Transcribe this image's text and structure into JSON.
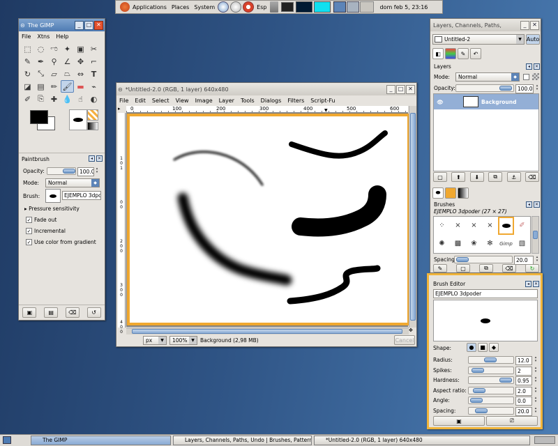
{
  "panel": {
    "applications": "Applications",
    "places": "Places",
    "system": "System",
    "keyboard": "Esp",
    "clock": "dom feb  5, 23:16"
  },
  "toolbox": {
    "title": "The GIMP",
    "menus": [
      "File",
      "Xtns",
      "Help"
    ]
  },
  "options": {
    "title": "Paintbrush",
    "opacity_label": "Opacity:",
    "opacity_value": "100.0",
    "mode_label": "Mode:",
    "mode_value": "Normal",
    "brush_label": "Brush:",
    "brush_value": "EJEMPLO 3dpoder",
    "pressure": "Pressure sensitivity",
    "fade": "Fade out",
    "incremental": "Incremental",
    "gradient": "Use color from gradient"
  },
  "image": {
    "title": "*Untitled-2.0 (RGB, 1 layer) 640x480",
    "menus": [
      "File",
      "Edit",
      "Select",
      "View",
      "Image",
      "Layer",
      "Tools",
      "Dialogs",
      "Filters",
      "Script-Fu"
    ],
    "ruler": [
      "0",
      "100",
      "200",
      "300",
      "400",
      "500",
      "600"
    ],
    "vruler": [
      "1",
      "0",
      "1",
      "0",
      "0",
      "2",
      "0",
      "0",
      "3",
      "0",
      "0",
      "4",
      "0",
      "0"
    ],
    "unit": "px",
    "zoom": "100%",
    "status": "Background (2,98 MB)",
    "cancel": "Cancel"
  },
  "layers_win": {
    "title": "Layers, Channels, Paths,",
    "image_select": "Untitled-2",
    "auto": "Auto",
    "layers_label": "Layers",
    "mode_label": "Mode:",
    "mode_value": "Normal",
    "opacity_label": "Opacity:",
    "opacity_value": "100.0",
    "layer_name": "Background",
    "brushes_label": "Brushes",
    "brush_name": "EJEMPLO 3dpoder (27 × 27)",
    "spacing_label": "Spacing:",
    "spacing_value": "20.0"
  },
  "brush_editor": {
    "title": "Brush Editor",
    "name": "EJEMPLO 3dpoder",
    "shape_label": "Shape:",
    "params": [
      {
        "label": "Radius:",
        "value": "12.0",
        "fill": 0.45
      },
      {
        "label": "Spikes:",
        "value": "2",
        "fill": 0.05
      },
      {
        "label": "Hardness:",
        "value": "0.95",
        "fill": 0.95
      },
      {
        "label": "Aspect ratio:",
        "value": "2.0",
        "fill": 0.1
      },
      {
        "label": "Angle:",
        "value": "0.0",
        "fill": 0.0
      },
      {
        "label": "Spacing:",
        "value": "20.0",
        "fill": 0.15
      }
    ]
  },
  "taskbar": {
    "items": [
      "The GIMP",
      "Layers, Channels, Paths, Undo | Brushes, Pattern...",
      "*Untitled-2.0 (RGB, 1 layer) 640x480"
    ]
  },
  "colors": {
    "accent": "#5c84b8",
    "selection": "#f0a830",
    "canvas": "#ffffff"
  }
}
